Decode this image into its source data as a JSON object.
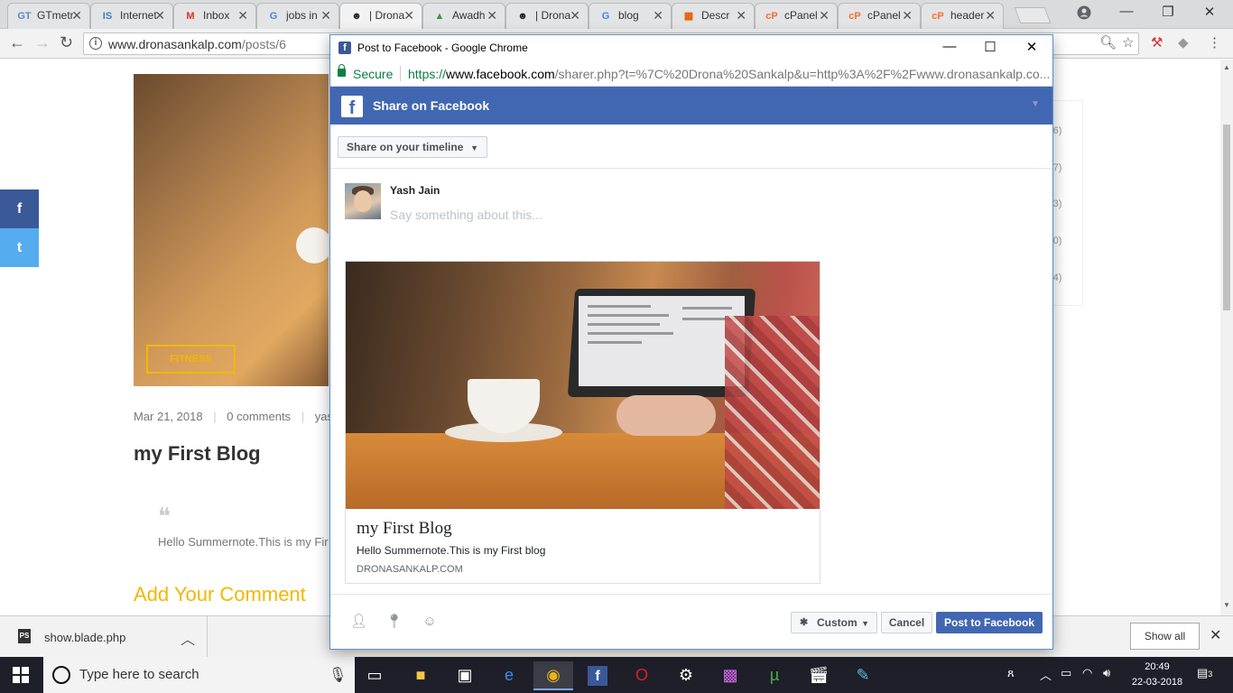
{
  "browser": {
    "tabs": [
      {
        "title": "GTmetrix",
        "favicon": "GT",
        "favicon_color": "#5b89c5"
      },
      {
        "title": "Internet",
        "favicon": "IS",
        "favicon_color": "#3b7fbf"
      },
      {
        "title": "Inbox",
        "favicon": "M",
        "favicon_color": "#d93025"
      },
      {
        "title": "jobs in",
        "favicon": "G",
        "favicon_color": "#4285f4"
      },
      {
        "title": "| Drona",
        "favicon": "☻",
        "favicon_color": "#222222"
      },
      {
        "title": "Awadh",
        "favicon": "▲",
        "favicon_color": "#2e9e44"
      },
      {
        "title": "| Drona",
        "favicon": "☻",
        "favicon_color": "#222222"
      },
      {
        "title": "blog",
        "favicon": "G",
        "favicon_color": "#4285f4"
      },
      {
        "title": "Descr",
        "favicon": "▦",
        "favicon_color": "#e65c00"
      },
      {
        "title": "cPanel",
        "favicon": "cP",
        "favicon_color": "#ff6c2c"
      },
      {
        "title": "cPanel",
        "favicon": "cP",
        "favicon_color": "#ff6c2c"
      },
      {
        "title": "header",
        "favicon": "cP",
        "favicon_color": "#ff6c2c"
      }
    ],
    "url_host": "www.dronasankalp.com",
    "url_path": "/posts/6"
  },
  "page": {
    "category": "FITNESS",
    "date": "Mar 21, 2018",
    "comments": "0 comments",
    "author": "yash",
    "post_title": "my First Blog",
    "quote_text": "Hello Summernote.This is my Fir",
    "add_comment": "Add Your Comment",
    "sidebar_counts": [
      "(6)",
      "(7)",
      "(3)",
      "(0)",
      "(4)"
    ]
  },
  "social": {
    "facebook_label": "f",
    "twitter_label": "t",
    "facebook_color": "#3b5998",
    "twitter_color": "#55acee"
  },
  "popup": {
    "window_title": "Post to Facebook - Google Chrome",
    "secure_label": "Secure",
    "url_scheme": "https://",
    "url_host": "www.facebook.com",
    "url_rest": "/sharer.php?t=%7C%20Drona%20Sankalp&u=http%3A%2F%2Fwww.dronasankalp.co...",
    "header_title": "Share on Facebook",
    "share_target": "Share on your timeline",
    "user_name": "Yash Jain",
    "say_placeholder": "Say something about this...",
    "preview_title": "my First Blog",
    "preview_description": "Hello Summernote.This is my First blog",
    "preview_domain": "DRONASANKALP.COM",
    "privacy_label": "Custom",
    "cancel_label": "Cancel",
    "post_label": "Post to Facebook",
    "brand_color": "#4267b2"
  },
  "downloads": {
    "file_name": "show.blade.php",
    "show_all_label": "Show all"
  },
  "taskbar": {
    "search_placeholder": "Type here to search",
    "time": "20:49",
    "date": "22-03-2018",
    "notification_count": "3"
  }
}
